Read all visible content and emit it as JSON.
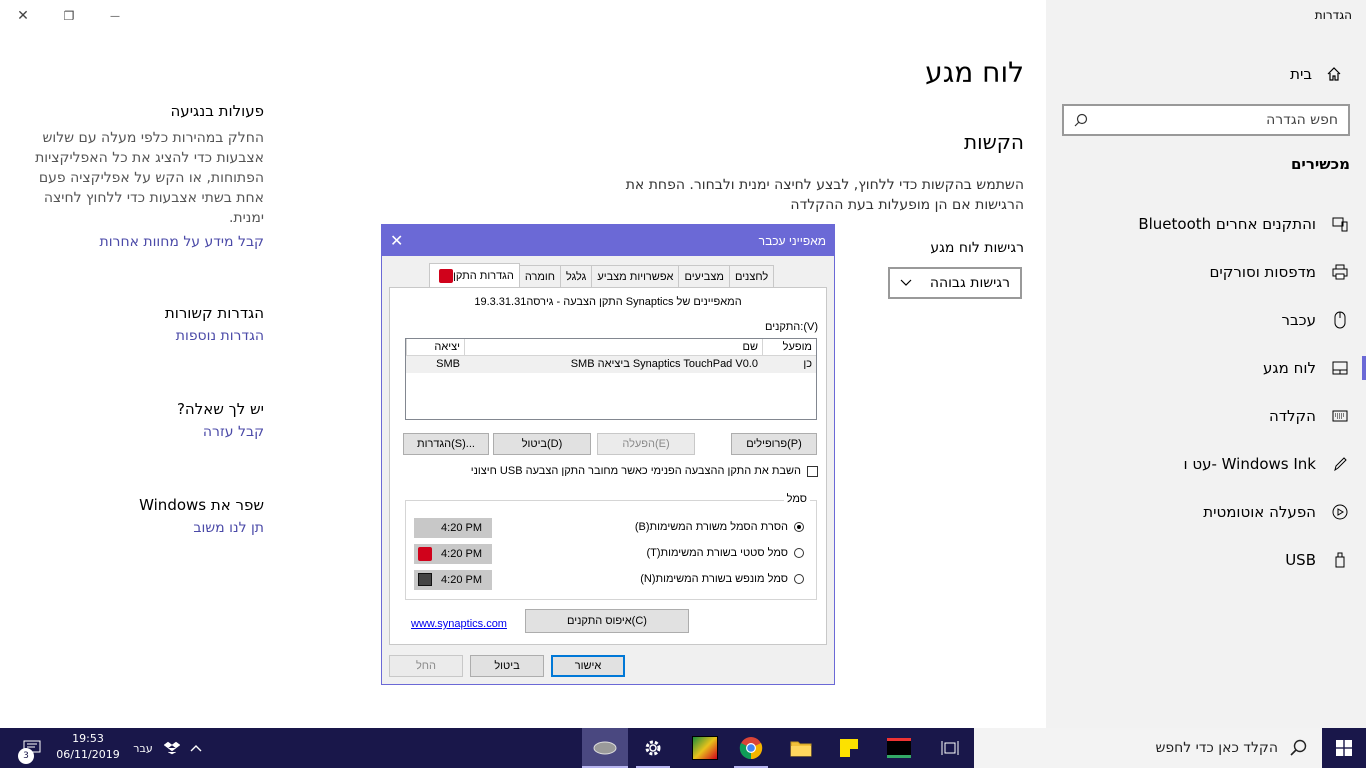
{
  "window": {
    "app_title": "הגדרות",
    "close": "✕",
    "restore": "❐",
    "minimize": "—"
  },
  "sidebar": {
    "home": "בית",
    "search_placeholder": "חפש הגדרה",
    "section": "מכשירים",
    "items": [
      {
        "label": "Bluetooth והתקנים אחרים",
        "icon": "bluetooth-devices-icon"
      },
      {
        "label": "מדפסות וסורקים",
        "icon": "printer-icon"
      },
      {
        "label": "עכבר",
        "icon": "mouse-icon"
      },
      {
        "label": "לוח מגע",
        "icon": "touchpad-icon",
        "active": true
      },
      {
        "label": "הקלדה",
        "icon": "keyboard-icon"
      },
      {
        "label": "עט ו- Windows Ink",
        "icon": "pen-icon"
      },
      {
        "label": "הפעלה אוטומטית",
        "icon": "autoplay-icon"
      },
      {
        "label": "USB",
        "icon": "usb-icon"
      }
    ]
  },
  "main": {
    "title": "לוח מגע",
    "taps_heading": "הקשות",
    "taps_desc": "השתמש בהקשות כדי ללחוץ, לבצע לחיצה ימנית ולבחור. הפחת את הרגישות אם הן מופעלות בעת ההקלדה",
    "sensitivity_label": "רגישות לוח מגע",
    "sensitivity_value": "רגישות גבוהה"
  },
  "related": {
    "gestures_title": "פעולות בנגיעה",
    "gestures_desc": "החלק במהירות כלפי מעלה עם שלוש אצבעות כדי להציג את כל האפליקציות הפתוחות, או הקש על אפליקציה פעם אחת בשתי אצבעות כדי ללחוץ לחיצה ימנית.",
    "gestures_link": "קבל מידע על מחוות אחרות",
    "related_title": "הגדרות קשורות",
    "related_link": "הגדרות נוספות",
    "question_title": "יש לך שאלה?",
    "question_link": "קבל עזרה",
    "improve_title": "שפר את Windows",
    "improve_link": "תן לנו משוב"
  },
  "dialog": {
    "title": "מאפייני עכבר",
    "close": "✕",
    "tabs": [
      "לחצנים",
      "מצביעים",
      "אפשרויות מצביע",
      "גלגל",
      "חומרה",
      "הגדרות התקן"
    ],
    "header": "המאפיינים של Synaptics התקן הצבעה - גירסה19.3.31.31",
    "devices_label": "התקנים:(V)",
    "columns": [
      "מופעל",
      "שם",
      "יציאה"
    ],
    "row": {
      "enabled": "כן",
      "name": "Synaptics TouchPad V0.0 ביציאה SMB",
      "port": "SMB"
    },
    "btn_profiles": "פרופילים(P)",
    "btn_enable": "הפעלה(E)",
    "btn_disable": "ביטול(D)",
    "btn_settings": "הגדרות(S)...",
    "checkbox": "השבת את התקן ההצבעה הפנימי כאשר מחובר התקן הצבעה USB חיצוני",
    "group_label": "סמל",
    "radio": [
      "הסרת הסמל משורת המשימות(B)",
      "סמל סטטי בשורת המשימות(T)",
      "סמל מונפש בשורת המשימות(N)"
    ],
    "time": "4:20 PM",
    "link": "www.synaptics.com",
    "btn_reset": "איפוס התקנים(C)",
    "btn_ok": "אישור",
    "btn_cancel": "ביטול",
    "btn_apply": "החל"
  },
  "taskbar": {
    "search_placeholder": "הקלד כאן כדי לחפש",
    "time": "19:53",
    "date": "06/11/2019",
    "lang": "עבר",
    "notifications": "3"
  },
  "colors": {
    "accent": "#6b69d6",
    "taskbar": "#19174a",
    "link": "#4b4aa8"
  }
}
